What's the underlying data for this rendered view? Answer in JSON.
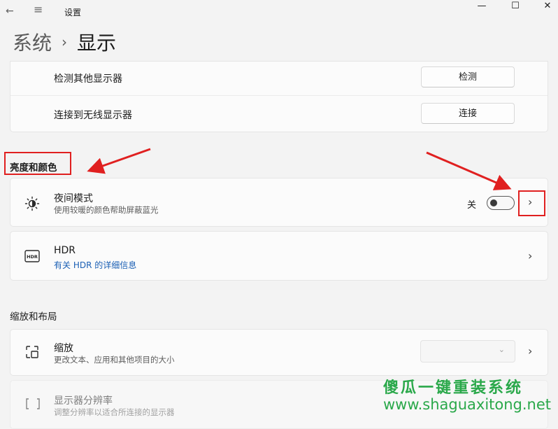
{
  "window": {
    "title": "设置",
    "back_glyph": "←",
    "menu_glyph": "≡",
    "minimize_glyph": "—",
    "maximize_glyph": "☐",
    "close_glyph": "✕"
  },
  "breadcrumb": {
    "parent": "系统",
    "separator": "›",
    "current": "显示"
  },
  "display_card": {
    "detect_label": "检测其他显示器",
    "detect_button": "检测",
    "wireless_label": "连接到无线显示器",
    "wireless_button": "连接"
  },
  "brightness_section": {
    "title": "亮度和颜色",
    "night_mode": {
      "label": "夜间模式",
      "desc": "使用较暖的颜色帮助屏蔽蓝光",
      "state_label": "关",
      "enabled": false
    },
    "hdr": {
      "label": "HDR",
      "link": "有关 HDR 的详细信息",
      "icon_text": "HDR"
    }
  },
  "layout_section": {
    "title": "缩放和布局",
    "scale": {
      "label": "缩放",
      "desc": "更改文本、应用和其他项目的大小",
      "value": ""
    },
    "resolution": {
      "label": "显示器分辨率",
      "desc": "调整分辨率以适合所连接的显示器"
    }
  },
  "chevron": "›",
  "watermark": {
    "cn": "傻瓜一键重装系统",
    "url": "www.shaguaxitong.net"
  },
  "colors": {
    "accent_link": "#1a5fb4",
    "annotation": "#e02020",
    "watermark": "#2aa84a"
  }
}
